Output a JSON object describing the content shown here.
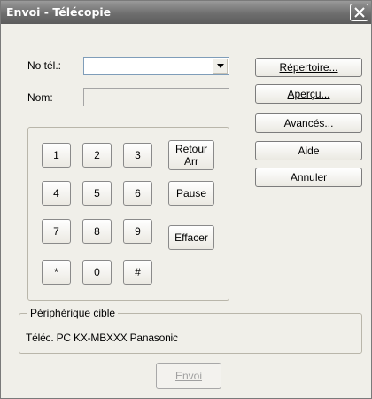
{
  "window": {
    "title": "Envoi - Télécopie"
  },
  "form": {
    "phone_label": "No tél.:",
    "phone_value": "",
    "name_label": "Nom:",
    "name_value": ""
  },
  "side_buttons": {
    "directory": "Répertoire...",
    "preview": "Aperçu...",
    "advanced": "Avancés...",
    "help": "Aide",
    "cancel": "Annuler"
  },
  "keypad": {
    "keys": [
      "1",
      "2",
      "3",
      "4",
      "5",
      "6",
      "7",
      "8",
      "9",
      "*",
      "0",
      "#"
    ],
    "backspace_line1": "Retour",
    "backspace_line2": "Arr",
    "pause": "Pause",
    "clear": "Effacer"
  },
  "device": {
    "legend": "Périphérique cible",
    "name": "Téléc. PC KX-MBXXX   Panasonic"
  },
  "send_button": "Envoi",
  "icons": {
    "close": "close-icon",
    "dropdown": "chevron-down-icon"
  }
}
